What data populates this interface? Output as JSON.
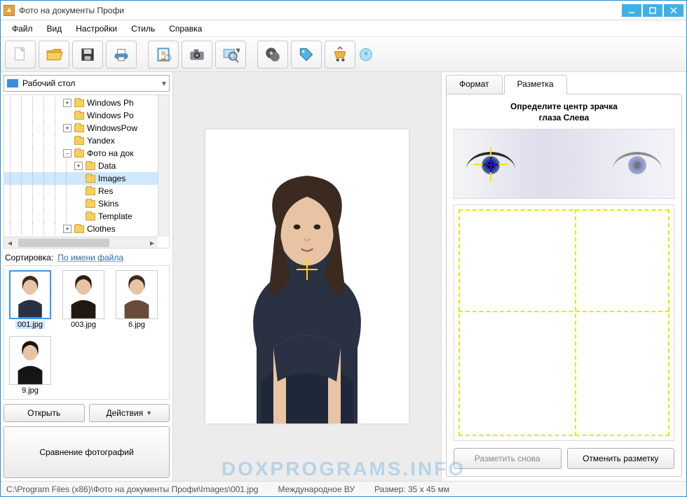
{
  "titlebar": {
    "title": "Фото на документы Профи"
  },
  "menu": {
    "file": "Файл",
    "view": "Вид",
    "settings": "Настройки",
    "style": "Стиль",
    "help": "Справка"
  },
  "toolbar": {
    "new": "new-icon",
    "open": "open-folder-icon",
    "save": "save-icon",
    "print": "print-icon",
    "crop": "crop-portrait-icon",
    "camera": "camera-icon",
    "zoom": "zoom-icon",
    "record": "record-icon",
    "tag": "tag-icon",
    "cart": "cart-icon",
    "close": "×"
  },
  "drive": {
    "label": "Рабочий стол"
  },
  "tree": [
    {
      "indent": 5,
      "toggle": "+",
      "label": "Windows Ph"
    },
    {
      "indent": 5,
      "toggle": "",
      "label": "Windows Po"
    },
    {
      "indent": 5,
      "toggle": "+",
      "label": "WindowsPow"
    },
    {
      "indent": 5,
      "toggle": "",
      "label": "Yandex"
    },
    {
      "indent": 5,
      "toggle": "-",
      "label": "Фото на док"
    },
    {
      "indent": 6,
      "toggle": "+",
      "label": "Data"
    },
    {
      "indent": 6,
      "toggle": "",
      "label": "Images",
      "selected": true
    },
    {
      "indent": 6,
      "toggle": "",
      "label": "Res"
    },
    {
      "indent": 6,
      "toggle": "",
      "label": "Skins"
    },
    {
      "indent": 6,
      "toggle": "",
      "label": "Template"
    },
    {
      "indent": 5,
      "toggle": "+",
      "label": "Clothes"
    }
  ],
  "sort": {
    "label": "Сортировка:",
    "link": "По имени файла"
  },
  "thumbs": [
    {
      "label": "001.jpg",
      "selected": true,
      "hair": "#3b2a1f",
      "suit": "#2a3142"
    },
    {
      "label": "003.jpg",
      "selected": false,
      "hair": "#2a2018",
      "suit": "#201812"
    },
    {
      "label": "6.jpg",
      "selected": false,
      "hair": "#402a20",
      "suit": "#6a4a3a"
    },
    {
      "label": "9.jpg",
      "selected": false,
      "hair": "#1a1410",
      "suit": "#151515"
    }
  ],
  "leftButtons": {
    "open": "Открыть",
    "actions": "Действия",
    "compare": "Сравнение фотографий"
  },
  "tabs": {
    "format": "Формат",
    "markup": "Разметка"
  },
  "rightPanel": {
    "heading_l1": "Определите центр зрачка",
    "heading_l2": "глаза Слева",
    "btn_again": "Разметить снова",
    "btn_cancel": "Отменить разметку"
  },
  "status": {
    "path": "C:\\Program Files (x86)\\Фото на документы Профи\\Images\\001.jpg",
    "doc": "Международное ВУ",
    "size": "Размер: 35 x 45 мм"
  },
  "watermark": "DOXPROGRAMS.INFO"
}
